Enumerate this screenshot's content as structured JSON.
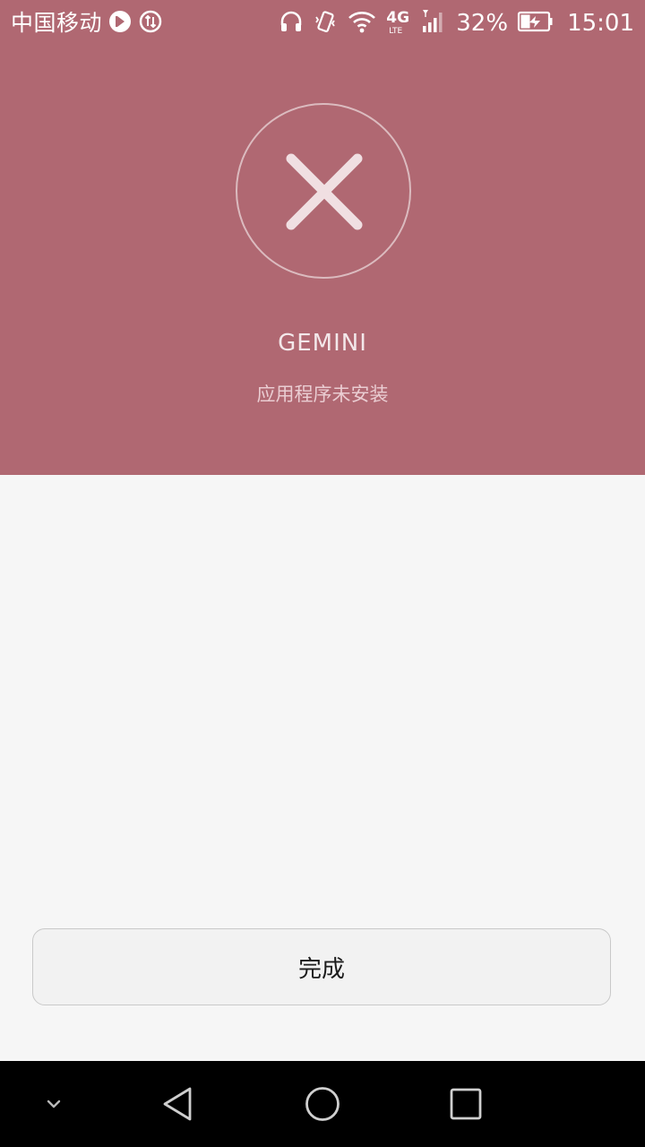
{
  "status_bar": {
    "carrier": "中国移动",
    "network": "4G",
    "network_sub": "LTE",
    "battery": "32%",
    "time": "15:01",
    "icons": [
      "play-circle-icon",
      "data-sync-icon",
      "headphones-icon",
      "vibrate-icon",
      "wifi-icon",
      "signal-icon",
      "battery-charging-icon"
    ]
  },
  "result": {
    "app_name": "GEMINI",
    "status": "应用程序未安装",
    "icon": "close-icon",
    "accent_color": "#b06872"
  },
  "actions": {
    "done_label": "完成"
  },
  "nav_bar": {
    "items": [
      "chevron-down-icon",
      "back-icon",
      "home-icon",
      "recents-icon"
    ]
  }
}
